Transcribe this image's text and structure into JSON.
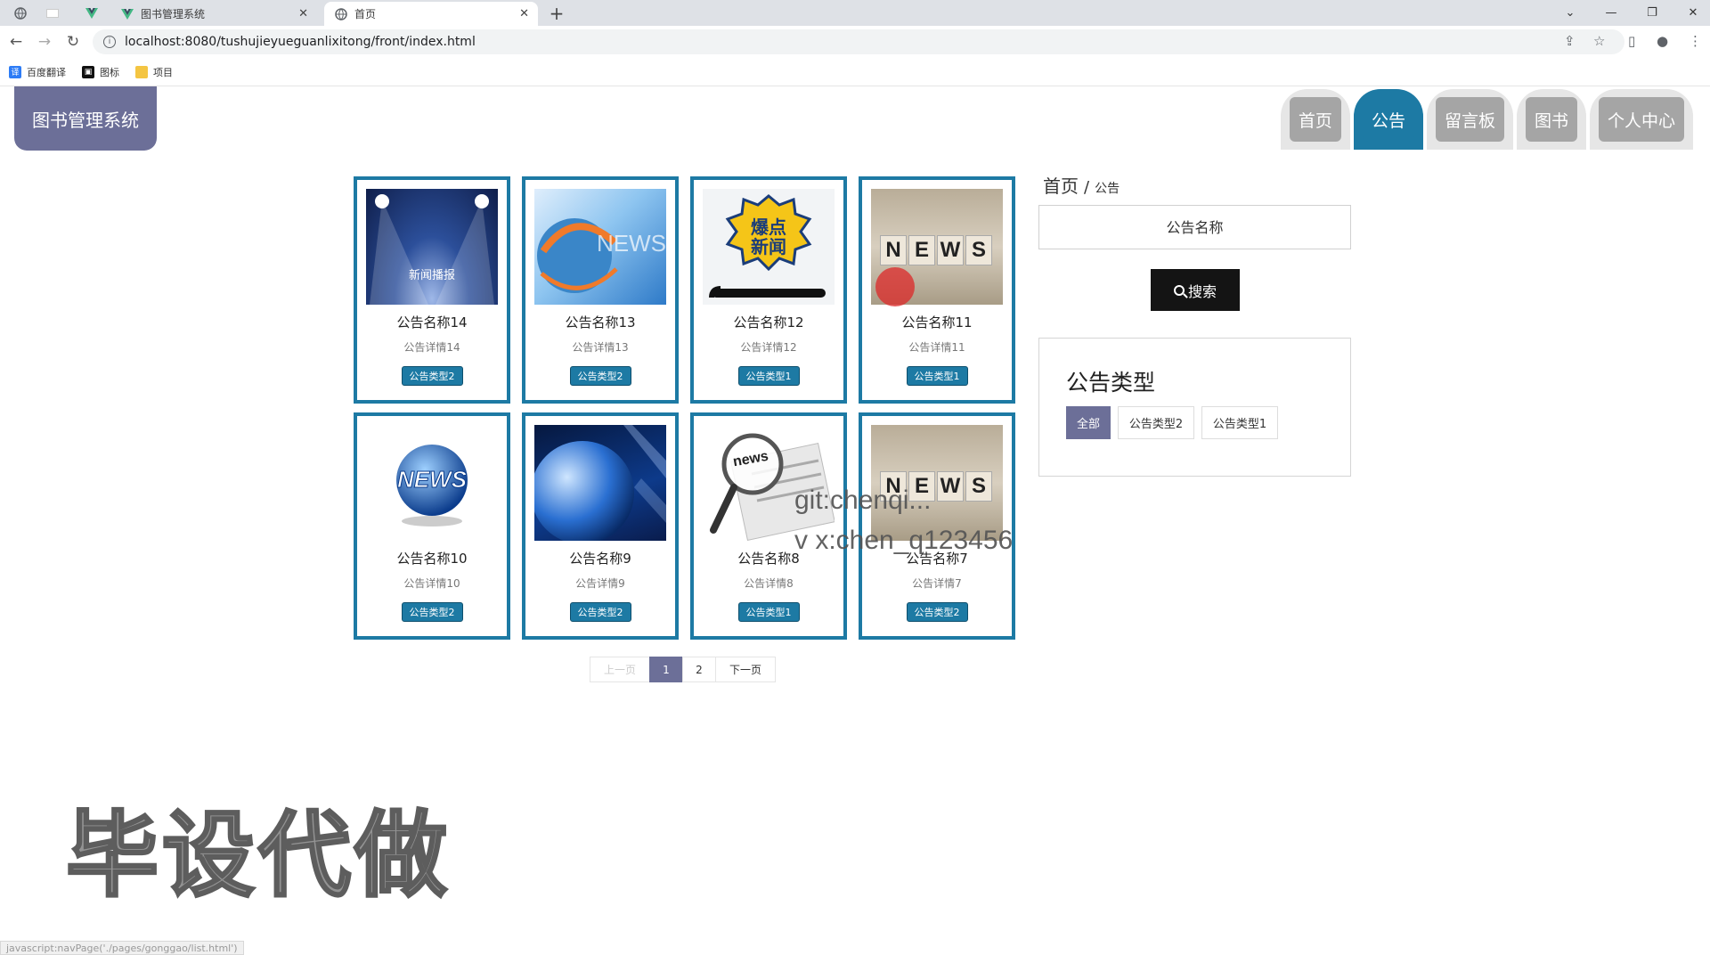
{
  "browser": {
    "tabs": [
      {
        "title": "图书管理系统",
        "active": false
      },
      {
        "title": "首页",
        "active": true
      }
    ],
    "url": "localhost:8080/tushujieyueguanlixitong/front/index.html",
    "bookmarks": [
      {
        "label": "百度翻译"
      },
      {
        "label": "图标"
      },
      {
        "label": "项目"
      }
    ],
    "status_url": "javascript:navPage('./pages/gonggao/list.html')"
  },
  "site": {
    "logo": "图书管理系统",
    "nav": [
      {
        "label": "首页",
        "active": false
      },
      {
        "label": "公告",
        "active": true
      },
      {
        "label": "留言板",
        "active": false
      },
      {
        "label": "图书",
        "active": false
      },
      {
        "label": "个人中心",
        "active": false
      }
    ]
  },
  "notices": [
    {
      "title": "公告名称14",
      "detail": "公告详情14",
      "type": "公告类型2",
      "image": "spotlight-news-broadcast"
    },
    {
      "title": "公告名称13",
      "detail": "公告详情13",
      "type": "公告类型2",
      "image": "news-globe-blue"
    },
    {
      "title": "公告名称12",
      "detail": "公告详情12",
      "type": "公告类型1",
      "image": "breaking-news-phone"
    },
    {
      "title": "公告名称11",
      "detail": "公告详情11",
      "type": "公告类型1",
      "image": "news-dice"
    },
    {
      "title": "公告名称10",
      "detail": "公告详情10",
      "type": "公告类型2",
      "image": "news-globe-3d"
    },
    {
      "title": "公告名称9",
      "detail": "公告详情9",
      "type": "公告类型2",
      "image": "earth-blue"
    },
    {
      "title": "公告名称8",
      "detail": "公告详情8",
      "type": "公告类型1",
      "image": "magnifier-newspaper"
    },
    {
      "title": "公告名称7",
      "detail": "公告详情7",
      "type": "公告类型2",
      "image": "news-dice"
    }
  ],
  "thumb_texts": {
    "spotlight": "新闻播报",
    "globe_news": "NEWS",
    "breaking_l1": "爆点",
    "breaking_l2": "新闻",
    "dice": "NEWS",
    "globe3d": "NEWS",
    "magnifier": "news"
  },
  "pagination": {
    "prev": "上一页",
    "pages": [
      "1",
      "2"
    ],
    "current": "1",
    "next": "下一页"
  },
  "sidebar": {
    "breadcrumb_home": "首页",
    "breadcrumb_sep": "/",
    "breadcrumb_current": "公告",
    "search_placeholder": "公告名称",
    "search_button": "搜索",
    "type_title": "公告类型",
    "types": [
      {
        "label": "全部",
        "active": true
      },
      {
        "label": "公告类型2",
        "active": false
      },
      {
        "label": "公告类型1",
        "active": false
      }
    ]
  },
  "overlay": {
    "git": "git:chenqi...",
    "vx": "v x:chen_q123456",
    "big": "毕设代做"
  },
  "colors": {
    "accent": "#1d7aa4",
    "logo": "#6c6f98",
    "nav_inactive": "#a5a5a5",
    "search_button": "#141414"
  }
}
